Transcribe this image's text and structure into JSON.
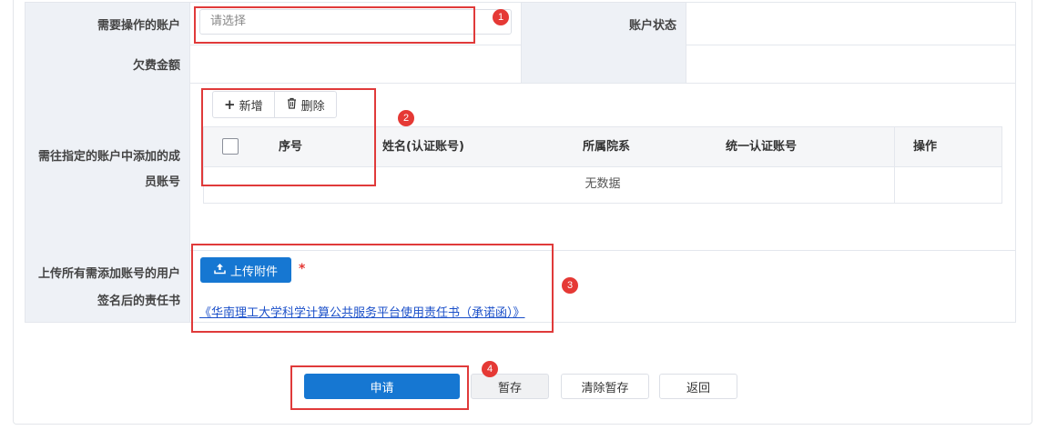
{
  "form": {
    "account_label": "需要操作的账户",
    "account_placeholder": "请选择",
    "status_label": "账户状态",
    "arrears_label": "欠费金额",
    "members_label_line1": "需往指定的账户中添加的成",
    "members_label_line2": "员账号",
    "upload_label_line1": "上传所有需添加账号的用户",
    "upload_label_line2": "签名后的责任书"
  },
  "toolbar": {
    "add_label": "新增",
    "delete_label": "删除"
  },
  "table": {
    "columns": [
      "序号",
      "姓名(认证账号)",
      "所属院系",
      "统一认证账号",
      "操作"
    ],
    "empty_text": "无数据"
  },
  "upload": {
    "button_label": "上传附件",
    "required_mark": "*",
    "pledge_link": "《华南理工大学科学计算公共服务平台使用责任书（承诺函）》"
  },
  "actions": {
    "apply": "申请",
    "save_draft": "暂存",
    "clear_draft": "清除暂存",
    "back": "返回"
  },
  "annotations": [
    "1",
    "2",
    "3",
    "4"
  ],
  "colors": {
    "primary": "#1677d2",
    "annotation": "#e03a3a",
    "label_bg": "#eef1f6"
  }
}
